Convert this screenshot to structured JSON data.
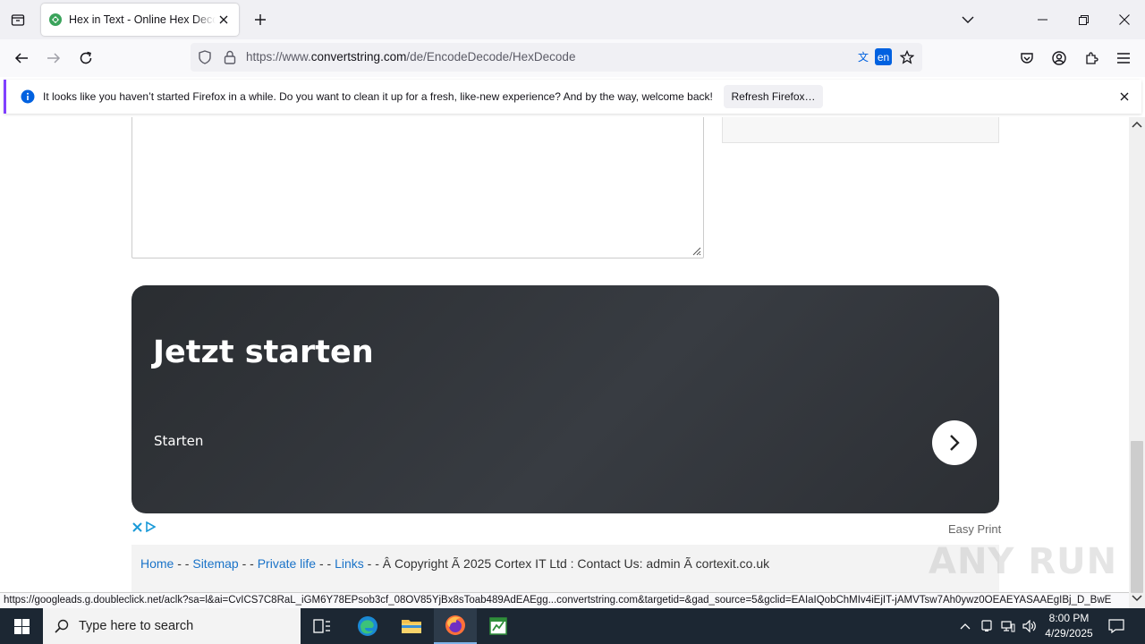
{
  "browser": {
    "tab": {
      "title": "Hex in Text - Online Hex Decoder"
    },
    "url": {
      "prefix": "https://www.",
      "host": "convertstring.com",
      "path": "/de/EncodeDecode/HexDecode"
    },
    "translate_lang": "en"
  },
  "notification": {
    "message": "It looks like you haven’t started Firefox in a while. Do you want to clean it up for a fresh, like-new experience? And by the way, welcome back!",
    "button_label": "Refresh Firefox…"
  },
  "ad": {
    "title": "Jetzt starten",
    "subtitle": "Starten",
    "easy_print": "Easy Print"
  },
  "footer": {
    "links": [
      "Home",
      "Sitemap",
      "Private life",
      "Links"
    ],
    "separator": " - - ",
    "copyright": "Â Copyright Ã 2025 Cortex IT Ltd : Contact Us: admin Ã cortexit.co.uk"
  },
  "status_url": "https://googleads.g.doubleclick.net/aclk?sa=l&ai=CvICS7C8RaL_iGM6Y78EPsob3cf_08OV85YjBx8sToab489AdEAEgg...convertstring.com&targetid=&gad_source=5&gclid=EAIaIQobChMIv4iEjIT-jAMVTsw7Ah0ywz0OEAEYASAAEgIBj_D_BwE",
  "watermark": "ANY RUN",
  "taskbar": {
    "search_placeholder": "Type here to search",
    "time": "8:00 PM",
    "date": "4/29/2025"
  },
  "colors": {
    "accent": "#0061e0",
    "notification_border": "#8040ff",
    "link": "#1a73c8",
    "ad_bg": "#2e3136"
  }
}
